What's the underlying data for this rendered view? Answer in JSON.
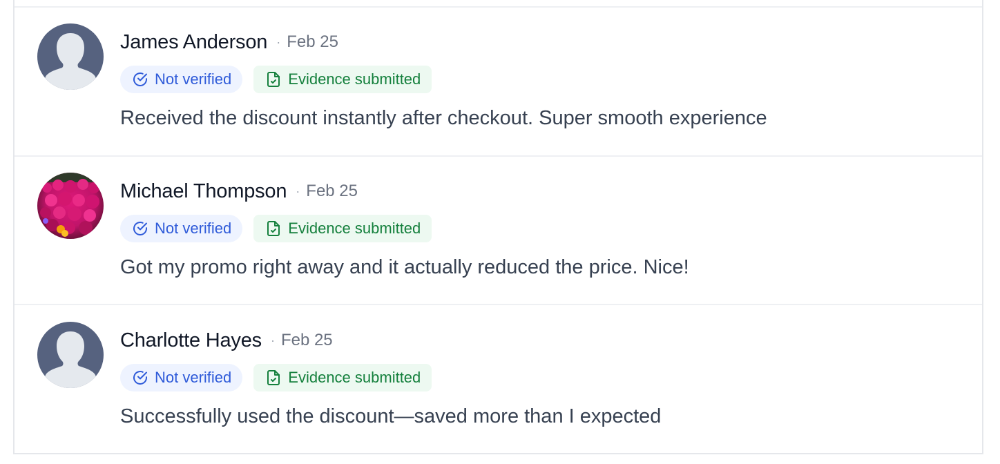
{
  "reviews": [
    {
      "name": "James Anderson",
      "separator": "·",
      "date": "Feb 25",
      "verification_label": "Not verified",
      "evidence_label": "Evidence submitted",
      "text": "Received the discount instantly after checkout. Super smooth experience",
      "avatar": "default-avatar"
    },
    {
      "name": "Michael Thompson",
      "separator": "·",
      "date": "Feb 25",
      "verification_label": "Not verified",
      "evidence_label": "Evidence submitted",
      "text": "Got my promo right away and it actually reduced the price. Nice!",
      "avatar": "flower-photo-avatar"
    },
    {
      "name": "Charlotte Hayes",
      "separator": "·",
      "date": "Feb 25",
      "verification_label": "Not verified",
      "evidence_label": "Evidence submitted",
      "text": "Successfully used the discount—saved more than I expected",
      "avatar": "default-avatar"
    }
  ],
  "colors": {
    "verify_bg": "#eef3ff",
    "verify_text": "#2f5bd9",
    "evidence_bg": "#edf9f1",
    "evidence_text": "#15803d",
    "avatar_bg": "#56627f"
  },
  "icons": {
    "verify": "check-circle-icon",
    "evidence": "file-check-icon"
  }
}
